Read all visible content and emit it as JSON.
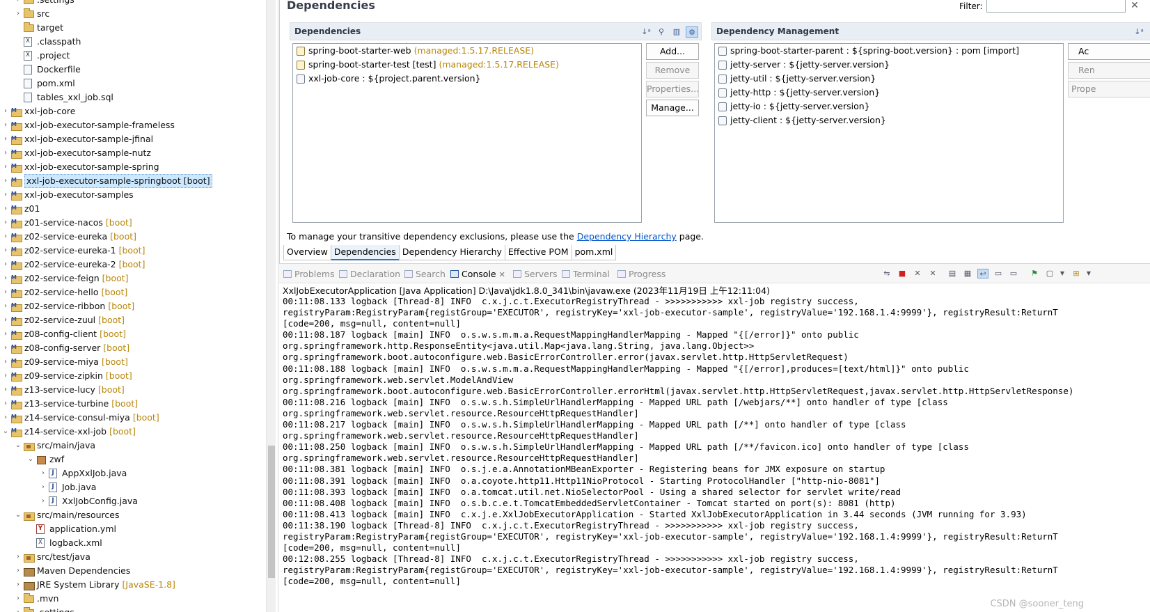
{
  "explorer": {
    "tree": [
      {
        "indent": 1,
        "arrow": "›",
        "icon": "folder",
        "label": ".settings",
        "dec": ""
      },
      {
        "indent": 1,
        "arrow": "›",
        "icon": "folder",
        "label": "src",
        "dec": ""
      },
      {
        "indent": 1,
        "arrow": "",
        "icon": "folder",
        "label": "target",
        "dec": ""
      },
      {
        "indent": 1,
        "arrow": "",
        "icon": "xfile",
        "label": ".classpath",
        "dec": ""
      },
      {
        "indent": 1,
        "arrow": "",
        "icon": "xfile",
        "label": ".project",
        "dec": ""
      },
      {
        "indent": 1,
        "arrow": "",
        "icon": "file",
        "label": "Dockerfile",
        "dec": ""
      },
      {
        "indent": 1,
        "arrow": "",
        "icon": "file",
        "label": "pom.xml",
        "dec": ""
      },
      {
        "indent": 1,
        "arrow": "",
        "icon": "file",
        "label": "tables_xxl_job.sql",
        "dec": ""
      },
      {
        "indent": 0,
        "arrow": "›",
        "icon": "proj",
        "label": "xxl-job-core",
        "dec": ""
      },
      {
        "indent": 0,
        "arrow": "›",
        "icon": "proj",
        "label": "xxl-job-executor-sample-frameless",
        "dec": ""
      },
      {
        "indent": 0,
        "arrow": "›",
        "icon": "proj",
        "label": "xxl-job-executor-sample-jfinal",
        "dec": ""
      },
      {
        "indent": 0,
        "arrow": "›",
        "icon": "proj",
        "label": "xxl-job-executor-sample-nutz",
        "dec": ""
      },
      {
        "indent": 0,
        "arrow": "›",
        "icon": "proj",
        "label": "xxl-job-executor-sample-spring",
        "dec": ""
      },
      {
        "indent": 0,
        "arrow": "›",
        "icon": "proj",
        "label": "xxl-job-executor-sample-springboot [boot]",
        "dec": "",
        "selected": true
      },
      {
        "indent": 0,
        "arrow": "›",
        "icon": "proj",
        "label": "xxl-job-executor-samples",
        "dec": ""
      },
      {
        "indent": 0,
        "arrow": "›",
        "icon": "proj",
        "label": "z01",
        "dec": ""
      },
      {
        "indent": 0,
        "arrow": "›",
        "icon": "proj",
        "label": "z01-service-nacos",
        "dec": "[boot]"
      },
      {
        "indent": 0,
        "arrow": "›",
        "icon": "proj",
        "label": "z02-service-eureka",
        "dec": "[boot]"
      },
      {
        "indent": 0,
        "arrow": "›",
        "icon": "proj",
        "label": "z02-service-eureka-1",
        "dec": "[boot]"
      },
      {
        "indent": 0,
        "arrow": "›",
        "icon": "proj",
        "label": "z02-service-eureka-2",
        "dec": "[boot]"
      },
      {
        "indent": 0,
        "arrow": "›",
        "icon": "proj",
        "label": "z02-service-feign",
        "dec": "[boot]"
      },
      {
        "indent": 0,
        "arrow": "›",
        "icon": "proj",
        "label": "z02-service-hello",
        "dec": "[boot]"
      },
      {
        "indent": 0,
        "arrow": "›",
        "icon": "proj",
        "label": "z02-service-ribbon",
        "dec": "[boot]"
      },
      {
        "indent": 0,
        "arrow": "›",
        "icon": "proj",
        "label": "z02-service-zuul",
        "dec": "[boot]"
      },
      {
        "indent": 0,
        "arrow": "›",
        "icon": "proj",
        "label": "z08-config-client",
        "dec": "[boot]"
      },
      {
        "indent": 0,
        "arrow": "›",
        "icon": "proj",
        "label": "z08-config-server",
        "dec": "[boot]"
      },
      {
        "indent": 0,
        "arrow": "›",
        "icon": "proj",
        "label": "z09-service-miya",
        "dec": "[boot]"
      },
      {
        "indent": 0,
        "arrow": "›",
        "icon": "proj",
        "label": "z09-service-zipkin",
        "dec": "[boot]"
      },
      {
        "indent": 0,
        "arrow": "›",
        "icon": "proj",
        "label": "z13-service-lucy",
        "dec": "[boot]"
      },
      {
        "indent": 0,
        "arrow": "›",
        "icon": "proj",
        "label": "z13-service-turbine",
        "dec": "[boot]"
      },
      {
        "indent": 0,
        "arrow": "›",
        "icon": "proj",
        "label": "z14-service-consul-miya",
        "dec": "[boot]"
      },
      {
        "indent": 0,
        "arrow": "⌄",
        "icon": "proj",
        "label": "z14-service-xxl-job",
        "dec": "[boot]"
      },
      {
        "indent": 1,
        "arrow": "⌄",
        "icon": "pkgroot",
        "label": "src/main/java",
        "dec": ""
      },
      {
        "indent": 2,
        "arrow": "⌄",
        "icon": "pkg",
        "label": "zwf",
        "dec": ""
      },
      {
        "indent": 3,
        "arrow": "›",
        "icon": "jfile",
        "label": "AppXxlJob.java",
        "dec": ""
      },
      {
        "indent": 3,
        "arrow": "›",
        "icon": "jfile",
        "label": "Job.java",
        "dec": ""
      },
      {
        "indent": 3,
        "arrow": "›",
        "icon": "jfile",
        "label": "XxlJobConfig.java",
        "dec": ""
      },
      {
        "indent": 1,
        "arrow": "⌄",
        "icon": "pkgroot",
        "label": "src/main/resources",
        "dec": ""
      },
      {
        "indent": 2,
        "arrow": "",
        "icon": "yml",
        "label": "application.yml",
        "dec": ""
      },
      {
        "indent": 2,
        "arrow": "",
        "icon": "xfile",
        "label": "logback.xml",
        "dec": ""
      },
      {
        "indent": 1,
        "arrow": "›",
        "icon": "pkgroot",
        "label": "src/test/java",
        "dec": ""
      },
      {
        "indent": 1,
        "arrow": "›",
        "icon": "lib",
        "label": "Maven Dependencies",
        "dec": ""
      },
      {
        "indent": 1,
        "arrow": "›",
        "icon": "lib",
        "label": "JRE System Library",
        "dec": "[JavaSE-1.8]"
      },
      {
        "indent": 1,
        "arrow": "›",
        "icon": "folder",
        "label": ".mvn",
        "dec": ""
      },
      {
        "indent": 1,
        "arrow": "›",
        "icon": "folder",
        "label": ".settings",
        "dec": ""
      }
    ]
  },
  "editor": {
    "title": "Dependencies",
    "filter_label": "Filter:",
    "filter_value": "",
    "filter_clear": "✕",
    "dependencies": {
      "title": "Dependencies",
      "items": [
        {
          "name": "spring-boot-starter-web",
          "managed": "(managed:1.5.17.RELEASE)",
          "icon": "managed"
        },
        {
          "name": "spring-boot-starter-test [test]",
          "managed": "(managed:1.5.17.RELEASE)",
          "icon": "managed"
        },
        {
          "name": "xxl-job-core : ${project.parent.version}",
          "managed": "",
          "icon": "plain"
        }
      ],
      "buttons": {
        "add": "Add...",
        "remove": "Remove",
        "properties": "Properties...",
        "manage": "Manage..."
      }
    },
    "management": {
      "title": "Dependency Management",
      "items": [
        "spring-boot-starter-parent : ${spring-boot.version} : pom [import]",
        "jetty-server : ${jetty-server.version}",
        "jetty-util : ${jetty-server.version}",
        "jetty-http : ${jetty-server.version}",
        "jetty-io : ${jetty-server.version}",
        "jetty-client : ${jetty-server.version}"
      ],
      "buttons": {
        "add": "Ac",
        "remove": "Ren",
        "properties": "Prope"
      }
    },
    "hint_before": "To manage your transitive dependency exclusions, please use the",
    "hint_link": "Dependency Hierarchy",
    "hint_after": "page.",
    "tabs": [
      "Overview",
      "Dependencies",
      "Dependency Hierarchy",
      "Effective POM",
      "pom.xml"
    ],
    "active_tab": "Dependencies"
  },
  "console": {
    "tabs": [
      {
        "label": "Problems",
        "active": false
      },
      {
        "label": "Declaration",
        "active": false
      },
      {
        "label": "Search",
        "active": false
      },
      {
        "label": "Console",
        "active": true,
        "closable": "✕"
      },
      {
        "label": "Servers",
        "active": false
      },
      {
        "label": "Terminal",
        "active": false
      },
      {
        "label": "Progress",
        "active": false
      }
    ],
    "title": "XxlJobExecutorApplication [Java Application] D:\\Java\\jdk1.8.0_341\\bin\\javaw.exe  (2023年11月19日 上午12:11:04)",
    "lines": [
      "00:11:08.133 logback [Thread-8] INFO  c.x.j.c.t.ExecutorRegistryThread - >>>>>>>>>>> xxl-job registry success,",
      "registryParam:RegistryParam{registGroup='EXECUTOR', registryKey='xxl-job-executor-sample', registryValue='192.168.1.4:9999'}, registryResult:ReturnT",
      "[code=200, msg=null, content=null]",
      "00:11:08.187 logback [main] INFO  o.s.w.s.m.m.a.RequestMappingHandlerMapping - Mapped \"{[/error]}\" onto public",
      "org.springframework.http.ResponseEntity<java.util.Map<java.lang.String, java.lang.Object>>",
      "org.springframework.boot.autoconfigure.web.BasicErrorController.error(javax.servlet.http.HttpServletRequest)",
      "00:11:08.188 logback [main] INFO  o.s.w.s.m.m.a.RequestMappingHandlerMapping - Mapped \"{[/error],produces=[text/html]}\" onto public",
      "org.springframework.web.servlet.ModelAndView",
      "org.springframework.boot.autoconfigure.web.BasicErrorController.errorHtml(javax.servlet.http.HttpServletRequest,javax.servlet.http.HttpServletResponse)",
      "00:11:08.216 logback [main] INFO  o.s.w.s.h.SimpleUrlHandlerMapping - Mapped URL path [/webjars/**] onto handler of type [class",
      "org.springframework.web.servlet.resource.ResourceHttpRequestHandler]",
      "00:11:08.217 logback [main] INFO  o.s.w.s.h.SimpleUrlHandlerMapping - Mapped URL path [/**] onto handler of type [class",
      "org.springframework.web.servlet.resource.ResourceHttpRequestHandler]",
      "00:11:08.250 logback [main] INFO  o.s.w.s.h.SimpleUrlHandlerMapping - Mapped URL path [/**/favicon.ico] onto handler of type [class",
      "org.springframework.web.servlet.resource.ResourceHttpRequestHandler]",
      "00:11:08.381 logback [main] INFO  o.s.j.e.a.AnnotationMBeanExporter - Registering beans for JMX exposure on startup",
      "00:11:08.391 logback [main] INFO  o.a.coyote.http11.Http11NioProtocol - Starting ProtocolHandler [\"http-nio-8081\"]",
      "00:11:08.393 logback [main] INFO  o.a.tomcat.util.net.NioSelectorPool - Using a shared selector for servlet write/read",
      "00:11:08.408 logback [main] INFO  o.s.b.c.e.t.TomcatEmbeddedServletContainer - Tomcat started on port(s): 8081 (http)",
      "00:11:08.413 logback [main] INFO  c.x.j.e.XxlJobExecutorApplication - Started XxlJobExecutorApplication in 3.44 seconds (JVM running for 3.93)",
      "00:11:38.190 logback [Thread-8] INFO  c.x.j.c.t.ExecutorRegistryThread - >>>>>>>>>>> xxl-job registry success,",
      "registryParam:RegistryParam{registGroup='EXECUTOR', registryKey='xxl-job-executor-sample', registryValue='192.168.1.4:9999'}, registryResult:ReturnT",
      "[code=200, msg=null, content=null]",
      "00:12:08.255 logback [Thread-8] INFO  c.x.j.c.t.ExecutorRegistryThread - >>>>>>>>>>> xxl-job registry success,",
      "registryParam:RegistryParam{registGroup='EXECUTOR', registryKey='xxl-job-executor-sample', registryValue='192.168.1.4:9999'}, registryResult:ReturnT",
      "[code=200, msg=null, content=null]"
    ]
  },
  "watermark": "CSDN @sooner_teng"
}
